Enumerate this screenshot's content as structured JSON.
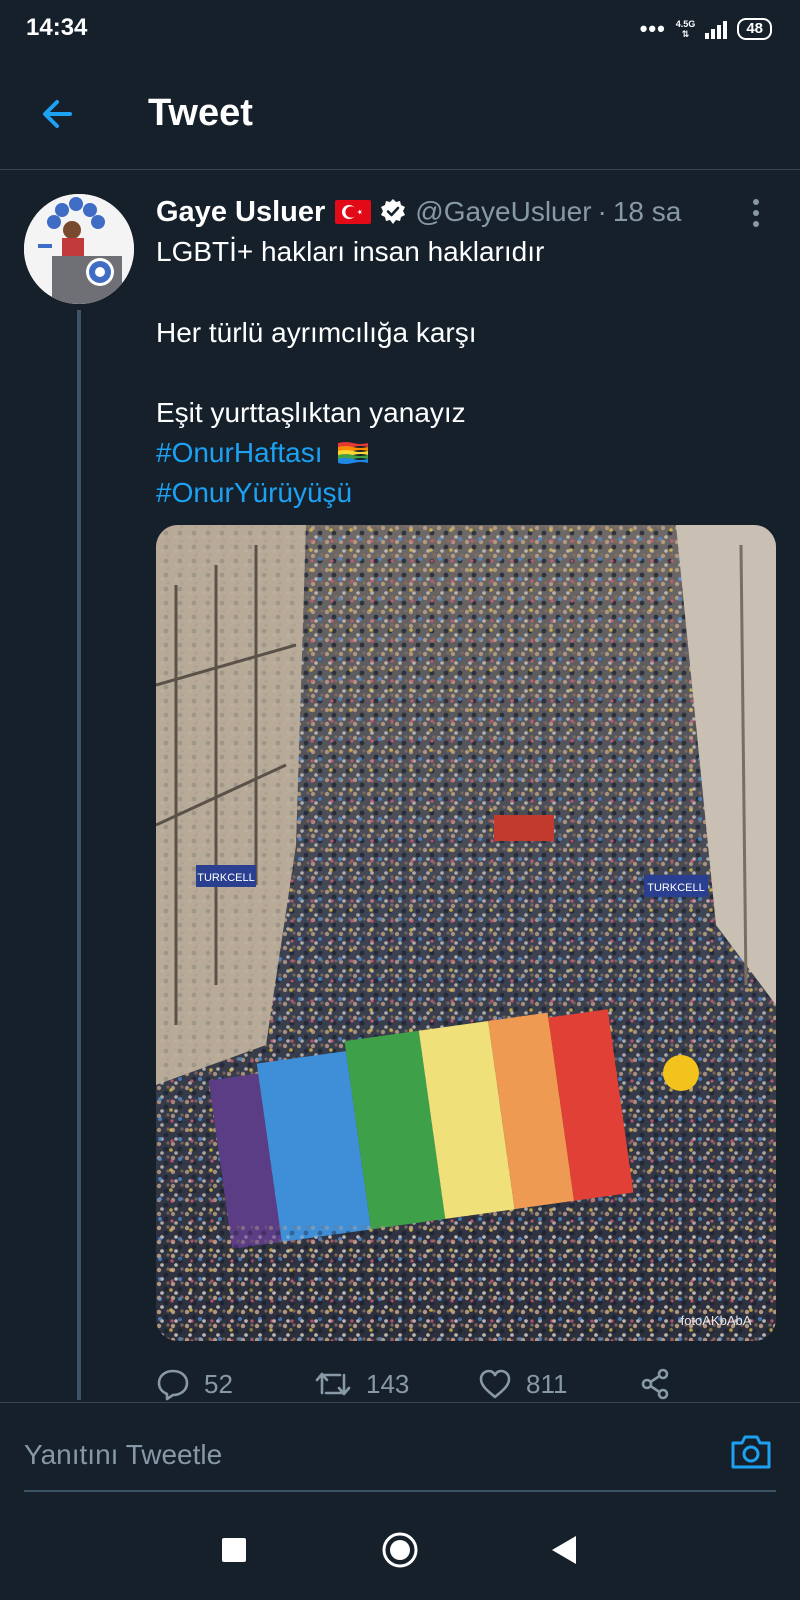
{
  "status_bar": {
    "time": "14:34",
    "network": "4.5G",
    "battery": "48"
  },
  "header": {
    "title": "Tweet"
  },
  "tweet": {
    "author_name": "Gaye Usluer",
    "handle": "@GayeUsluer",
    "separator": "·",
    "time": "18 sa",
    "lines": [
      "LGBTİ+ hakları insan haklarıdır",
      "Her türlü ayrımcılığa karşı",
      "Eşit yurttaşlıktan yanayız"
    ],
    "hashtags": [
      "#OnurHaftası",
      "#OnurYürüyüşü"
    ],
    "stats": {
      "replies": "52",
      "retweets": "143",
      "likes": "811"
    },
    "photo_banners": [
      "TURKCELL",
      "TURKCELL"
    ],
    "photo_credit": "fotoAKbAbA"
  },
  "reply": {
    "placeholder": "Yanıtını Tweetle"
  },
  "icons": {
    "back": "arrow-left-icon",
    "more": "more-vertical-icon",
    "reply": "reply-icon",
    "retweet": "retweet-icon",
    "like": "heart-icon",
    "share": "share-icon",
    "camera": "camera-icon"
  },
  "colors": {
    "background": "#15202b",
    "accent": "#1da1f2",
    "muted": "#8899a6",
    "divider": "#38444d"
  }
}
